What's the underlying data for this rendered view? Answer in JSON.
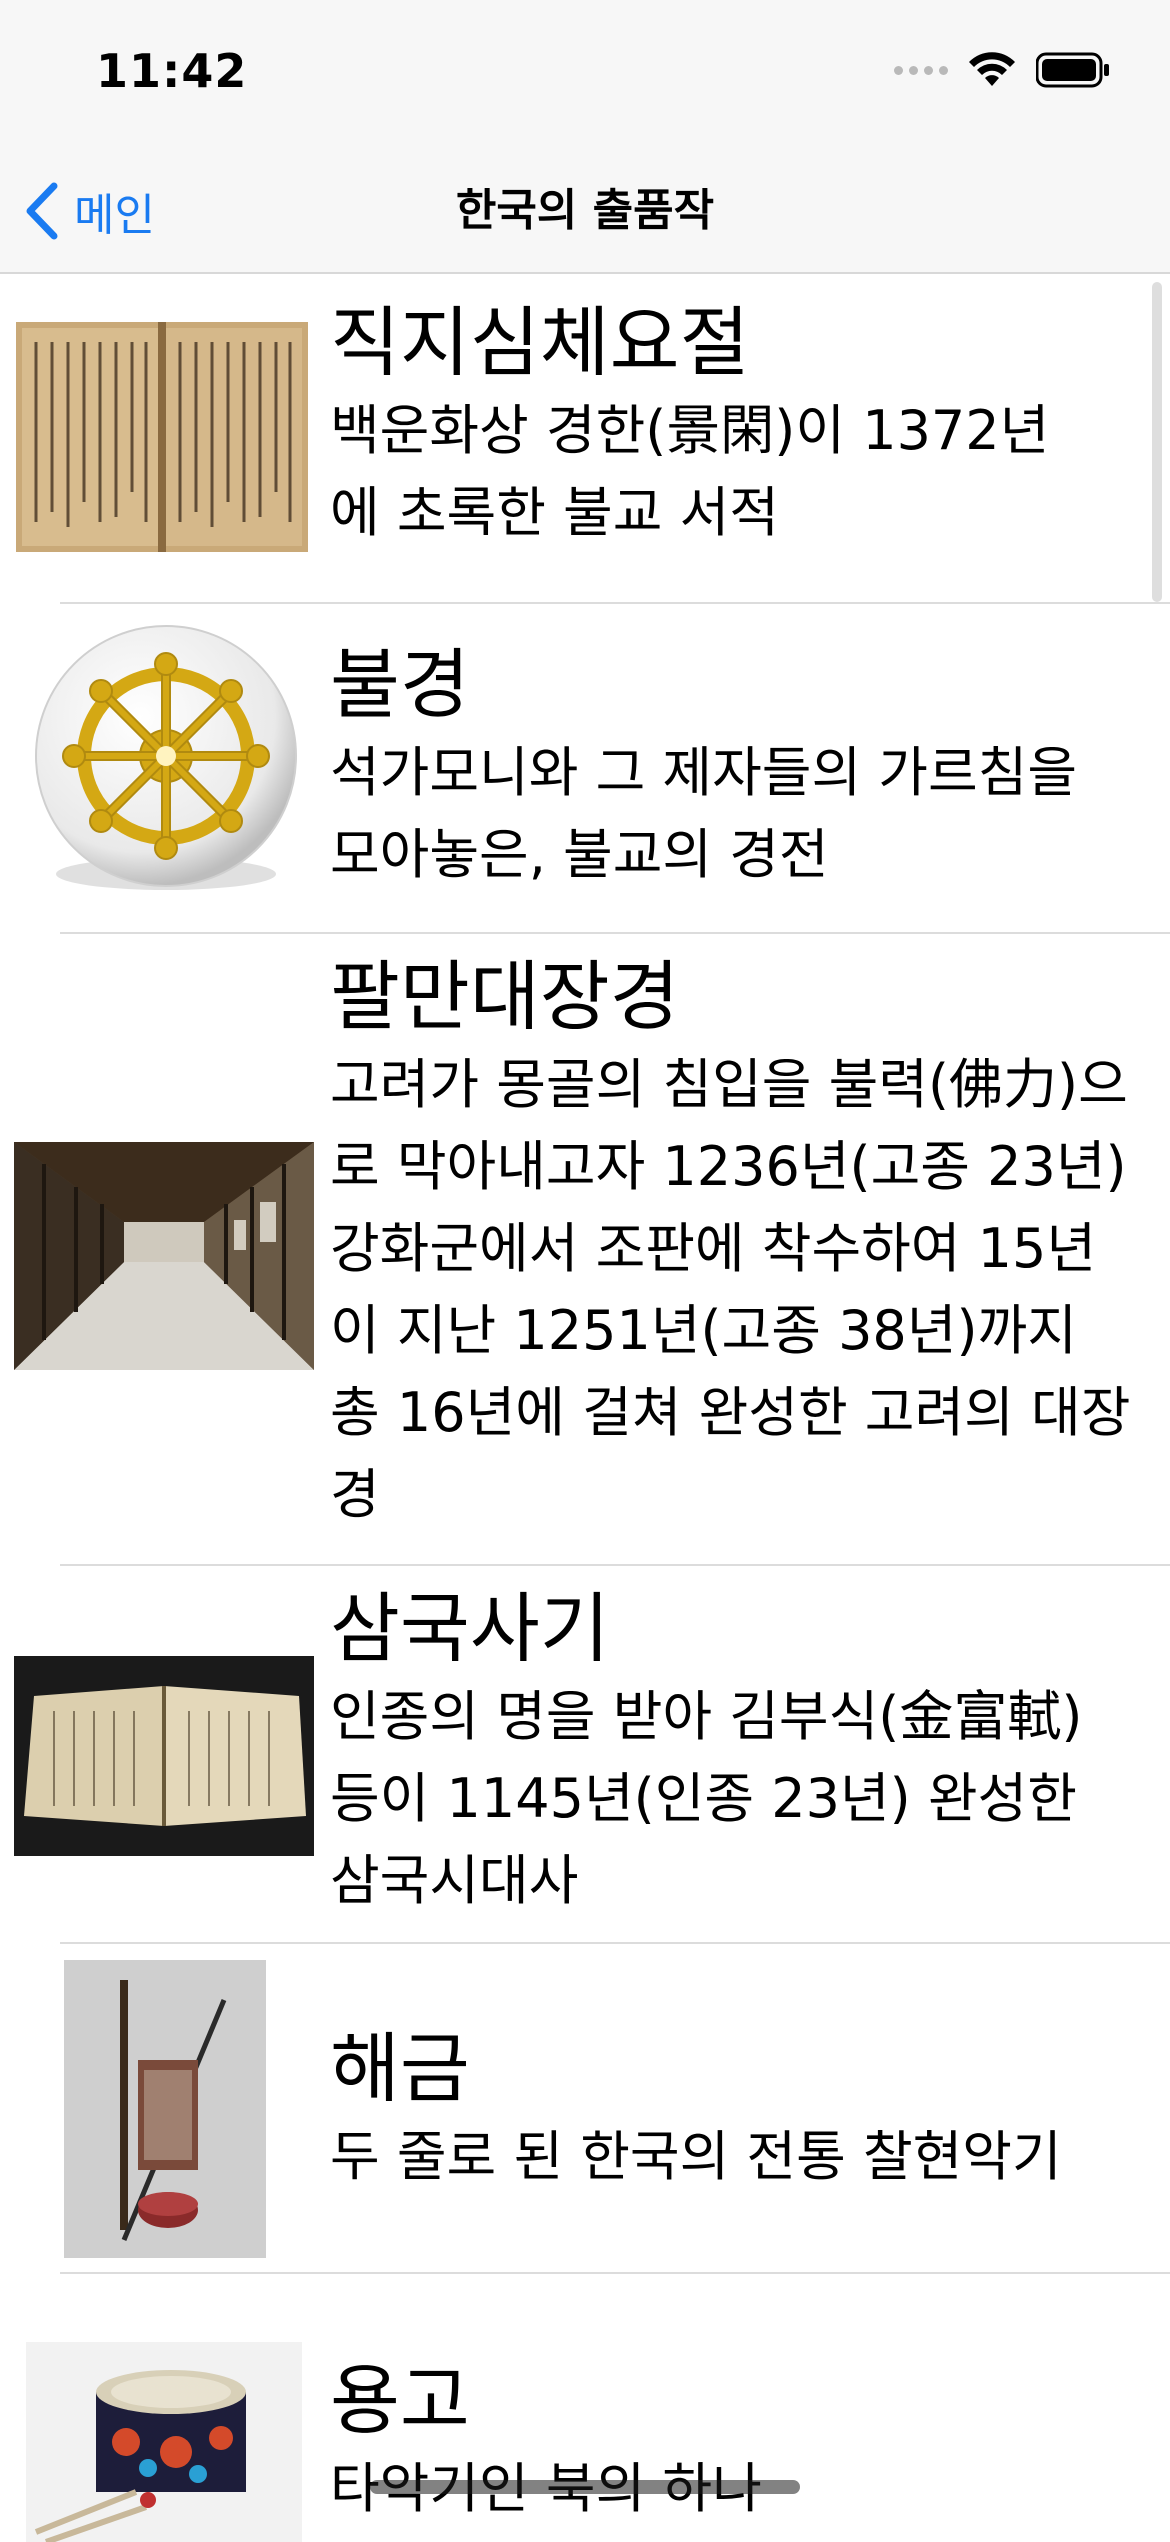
{
  "status": {
    "time": "11:42"
  },
  "nav": {
    "back_label": "메인",
    "title": "한국의 출품작"
  },
  "items": [
    {
      "title": "직지심체요절",
      "desc": "백운화상 경한(景閑)이 1372년에 초록한 불교 서적",
      "thumb_icon": "old-book-image"
    },
    {
      "title": "불경",
      "desc": "석가모니와 그 제자들의 가르침을 모아놓은, 불교의 경전",
      "thumb_icon": "dharma-wheel-icon"
    },
    {
      "title": "팔만대장경",
      "desc": "고려가 몽골의 침입을 불력(佛力)으로 막아내고자 1236년(고종 23년) 강화군에서 조판에 착수하여 15년이 지난 1251년(고종 38년)까지 총 16년에 걸쳐 완성한 고려의 대장경",
      "thumb_icon": "library-hall-image"
    },
    {
      "title": "삼국사기",
      "desc": "인종의 명을 받아 김부식(金富軾)등이 1145년(인종 23년) 완성한 삼국시대사",
      "thumb_icon": "open-book-image"
    },
    {
      "title": "해금",
      "desc": "두 줄로 된 한국의 전통 찰현악기",
      "thumb_icon": "haegeum-image"
    },
    {
      "title": "용고",
      "desc": "타악기인 북의 하나",
      "thumb_icon": "drum-image"
    }
  ],
  "colors": {
    "accent": "#1a7bf1",
    "bar_bg": "#f7f7f7",
    "separator": "#dcdcdc"
  }
}
